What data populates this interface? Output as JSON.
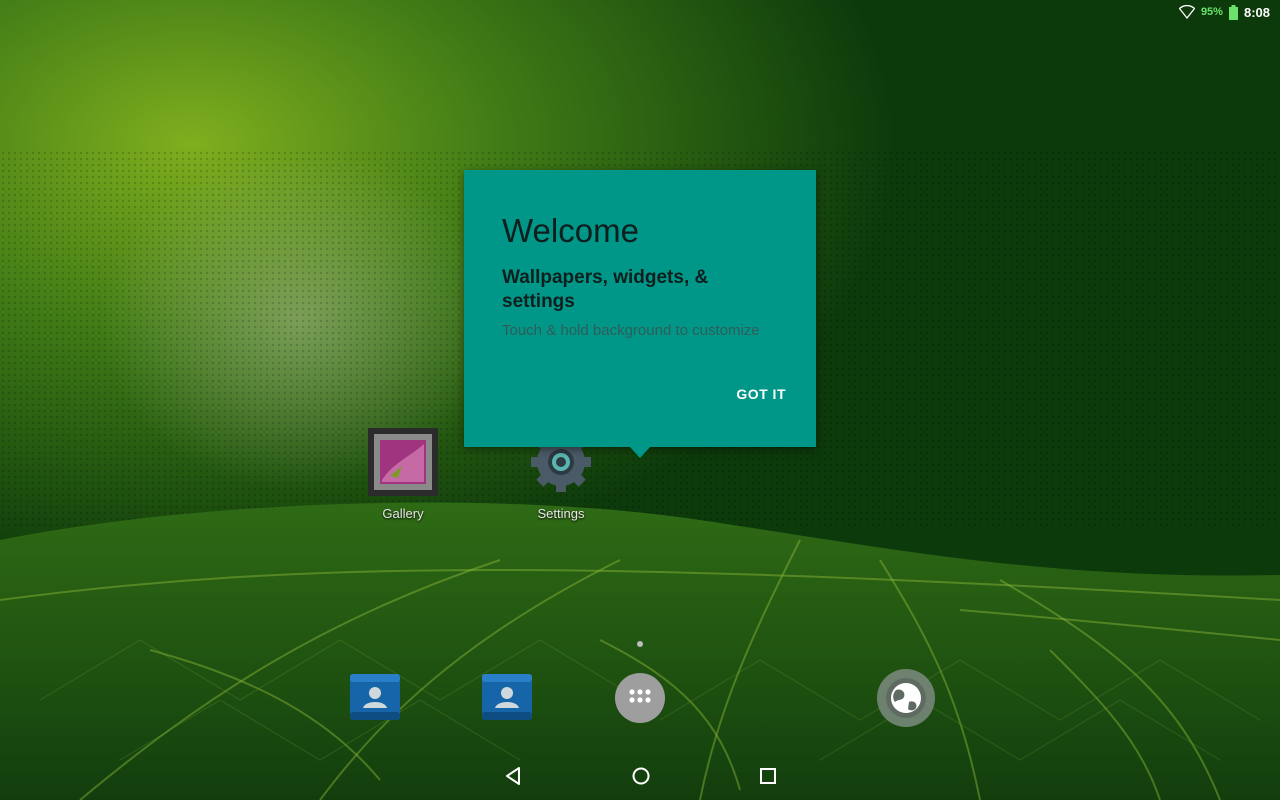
{
  "status_bar": {
    "battery_percent": "95%",
    "clock": "8:08",
    "icons": [
      "wifi-icon",
      "battery-icon"
    ]
  },
  "welcome_dialog": {
    "title": "Welcome",
    "subtitle": "Wallpapers, widgets, & settings",
    "description": "Touch & hold background to customize",
    "button_label": "GOT IT",
    "background_color": "#009688"
  },
  "home_apps": [
    {
      "label": "Gallery",
      "icon": "gallery-icon"
    },
    {
      "label": "Settings",
      "icon": "settings-gear-icon"
    }
  ],
  "dock": [
    {
      "icon": "contacts-icon"
    },
    {
      "icon": "contacts-icon"
    },
    {
      "icon": "all-apps-icon"
    },
    {
      "icon": "browser-globe-icon"
    }
  ],
  "nav_bar": {
    "buttons": [
      "back-icon",
      "home-icon",
      "recents-icon"
    ]
  }
}
